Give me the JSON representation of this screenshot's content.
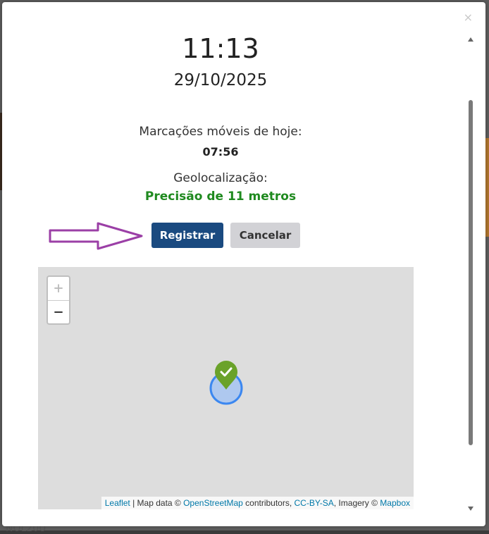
{
  "modal": {
    "close_label": "×",
    "time": "11:13",
    "date": "29/10/2025",
    "markings_label": "Marcações móveis de hoje:",
    "markings_value": "07:56",
    "geo_label": "Geolocalização:",
    "geo_value": "Precisão de 11 metros",
    "register_button": "Registrar",
    "cancel_button": "Cancelar"
  },
  "map": {
    "zoom_in": "+",
    "zoom_out": "−",
    "attribution": {
      "leaflet": "Leaflet",
      "sep1": " | Map data © ",
      "osm": "OpenStreetMap",
      "contributors": " contributors, ",
      "license": "CC-BY-SA",
      "imagery": ", Imagery © ",
      "mapbox": "Mapbox"
    }
  },
  "background": {
    "bottom_text": "NOL20U"
  },
  "colors": {
    "primary": "#1a4a80",
    "secondary": "#d2d2d6",
    "success": "#1f8a1f",
    "arrow": "#9b3fa6",
    "marker": "#6aa22a",
    "accuracy_circle": "#3b87f0",
    "link": "#0078a8"
  },
  "icons": {
    "arrow": "arrow-right-outline-icon",
    "marker": "map-marker-check-icon",
    "close": "close-icon"
  }
}
